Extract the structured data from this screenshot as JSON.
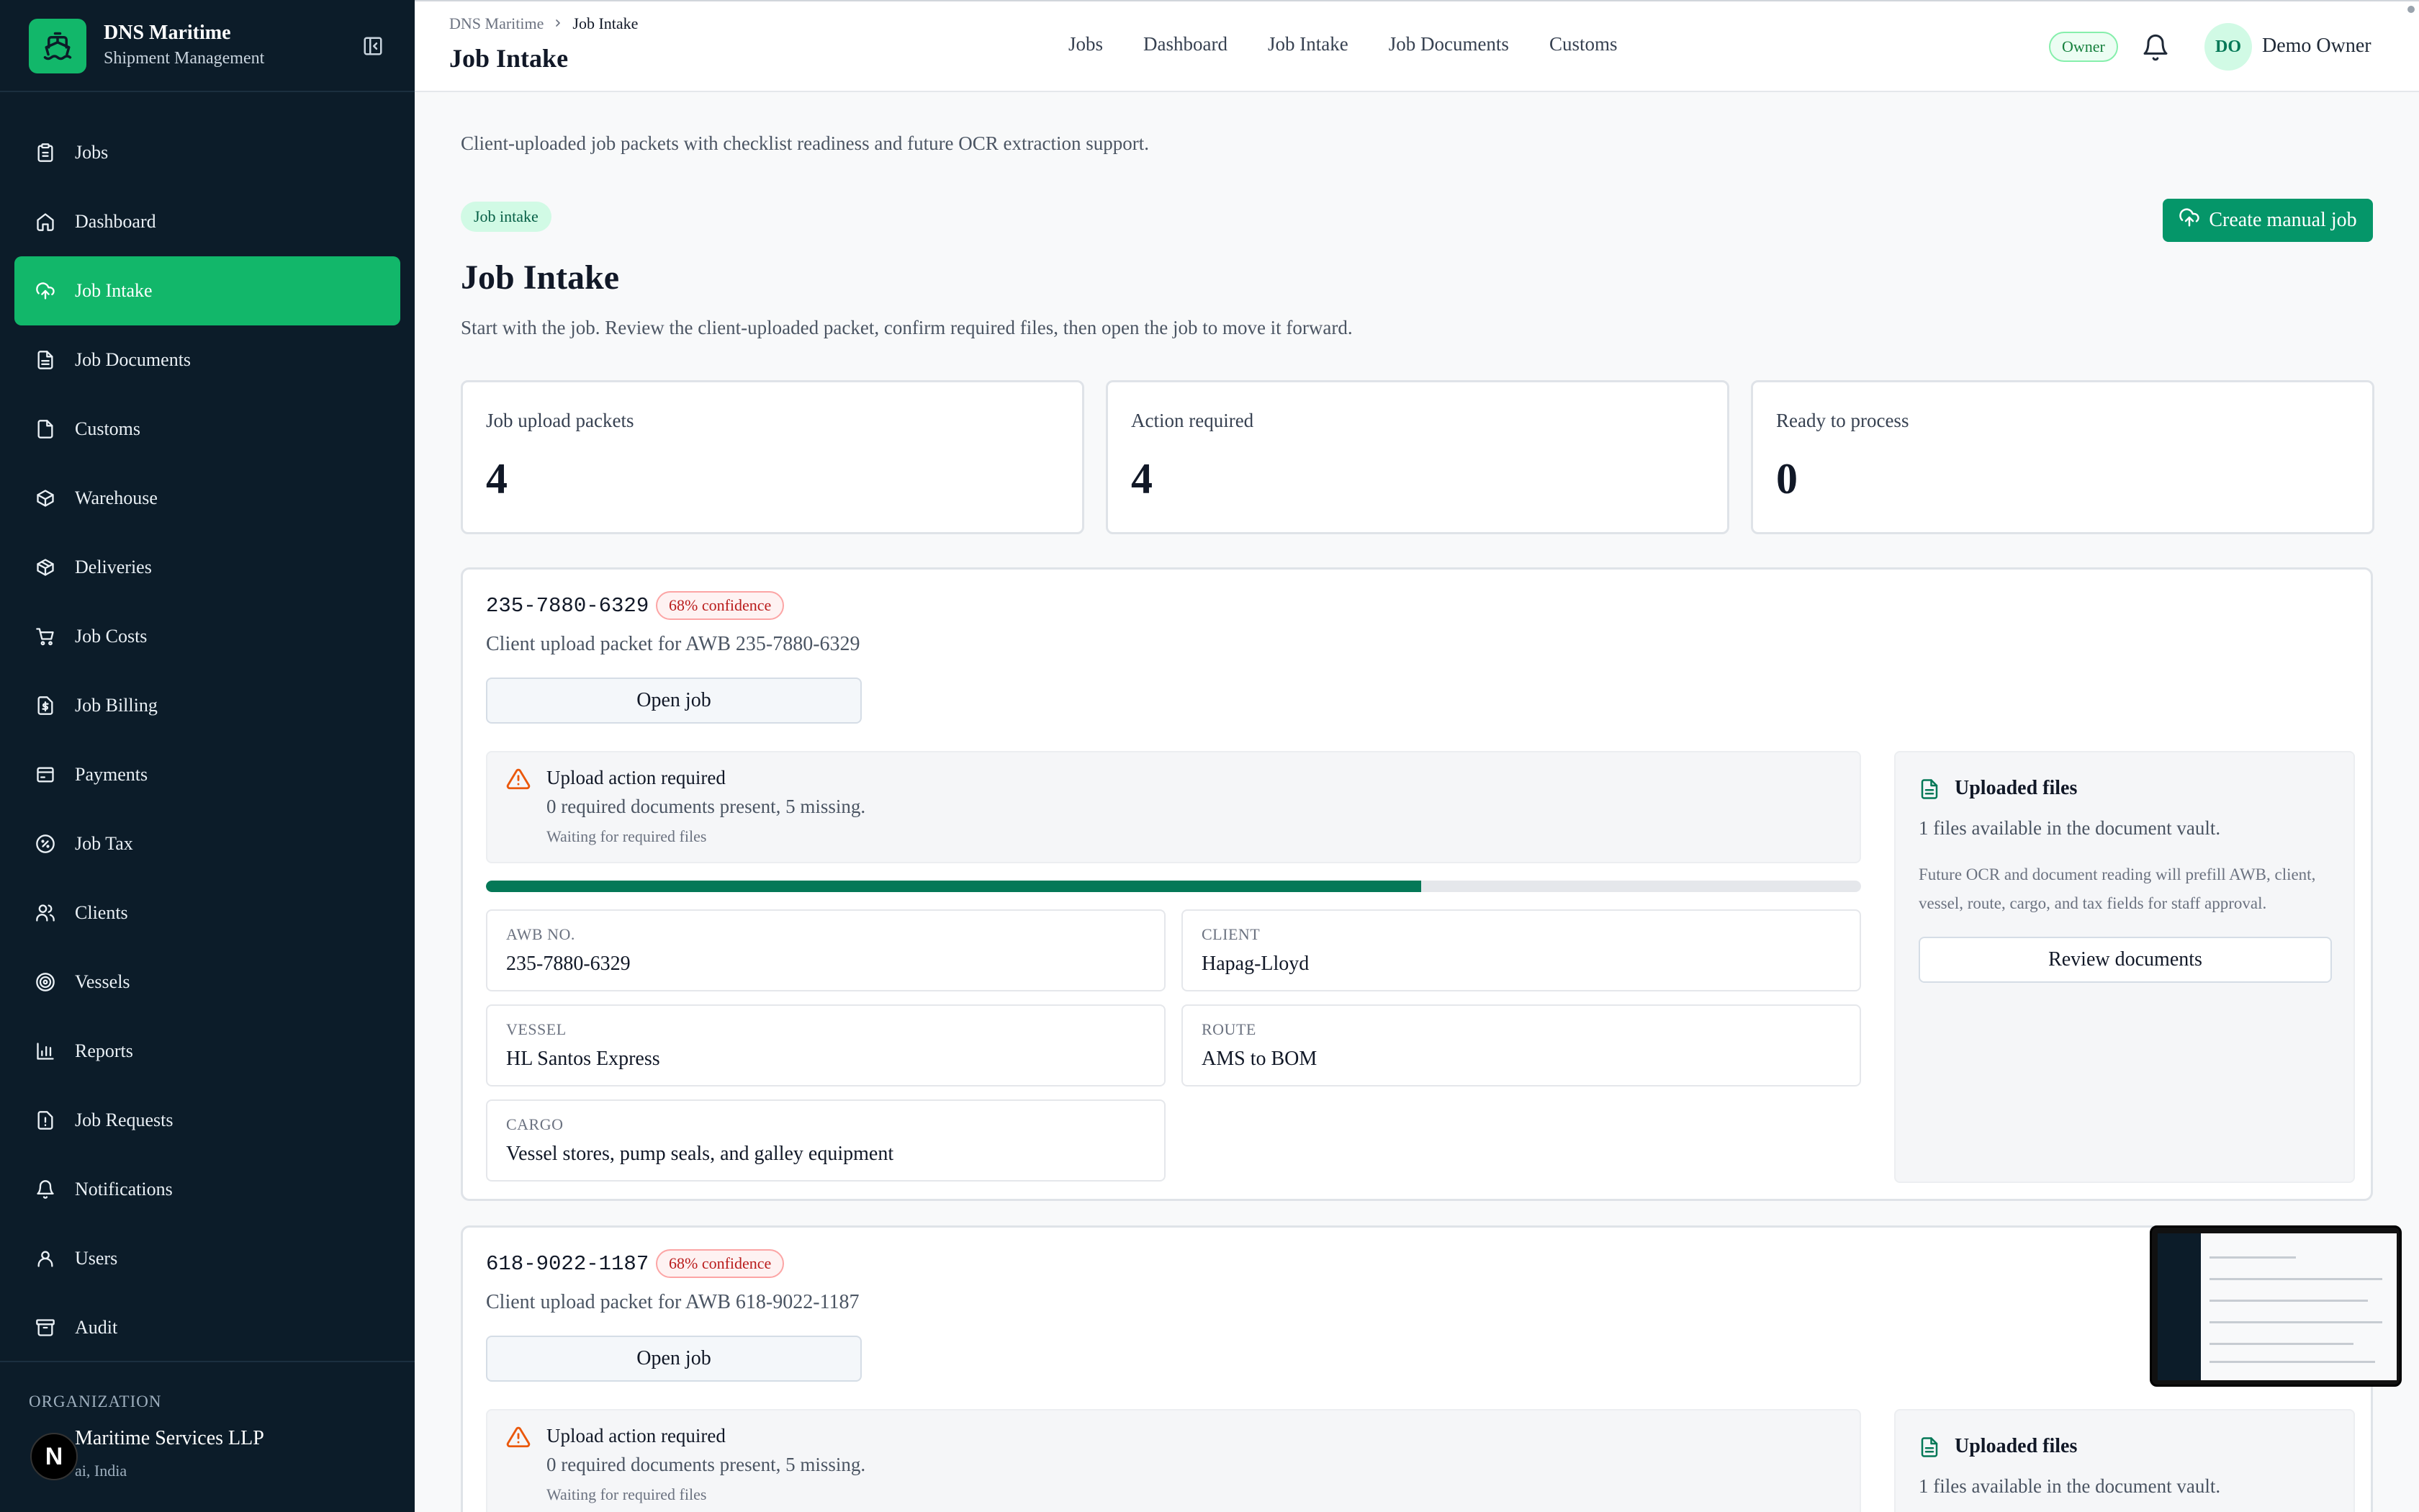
{
  "brand": {
    "title": "DNS Maritime",
    "subtitle": "Shipment Management"
  },
  "sidebar": {
    "items": [
      {
        "label": "Jobs",
        "icon": "clipboard-icon"
      },
      {
        "label": "Dashboard",
        "icon": "home-icon"
      },
      {
        "label": "Job Intake",
        "icon": "cloud-upload-icon",
        "active": true
      },
      {
        "label": "Job Documents",
        "icon": "file-text-icon"
      },
      {
        "label": "Customs",
        "icon": "file-icon"
      },
      {
        "label": "Warehouse",
        "icon": "package-icon"
      },
      {
        "label": "Deliveries",
        "icon": "box-icon"
      },
      {
        "label": "Job Costs",
        "icon": "cart-icon"
      },
      {
        "label": "Job Billing",
        "icon": "dollar-file-icon"
      },
      {
        "label": "Payments",
        "icon": "wallet-icon"
      },
      {
        "label": "Job Tax",
        "icon": "percent-badge-icon"
      },
      {
        "label": "Clients",
        "icon": "users-icon"
      },
      {
        "label": "Vessels",
        "icon": "target-icon"
      },
      {
        "label": "Reports",
        "icon": "bar-chart-icon"
      },
      {
        "label": "Job Requests",
        "icon": "file-alert-icon"
      },
      {
        "label": "Notifications",
        "icon": "bell-icon"
      },
      {
        "label": "Users",
        "icon": "user-icon"
      },
      {
        "label": "Audit",
        "icon": "archive-icon"
      }
    ],
    "org_label": "ORGANIZATION",
    "org_name": "Maritime Services LLP",
    "org_location": "ai, India"
  },
  "topbar": {
    "breadcrumb": [
      "DNS Maritime",
      "Job Intake"
    ],
    "title": "Job Intake",
    "nav": [
      "Jobs",
      "Dashboard",
      "Job Intake",
      "Job Documents",
      "Customs"
    ],
    "role": "Owner",
    "avatar_initials": "DO",
    "user_name": "Demo Owner"
  },
  "main": {
    "intro": "Client-uploaded job packets with checklist readiness and future OCR extraction support.",
    "chip": "Job intake",
    "create_button": "Create manual job",
    "title": "Job Intake",
    "subtitle": "Start with the job. Review the client-uploaded packet, confirm required files, then open the job to move it forward.",
    "stats": [
      {
        "label": "Job upload packets",
        "value": "4"
      },
      {
        "label": "Action required",
        "value": "4"
      },
      {
        "label": "Ready to process",
        "value": "0"
      }
    ],
    "packets": [
      {
        "awb": "235-7880-6329",
        "confidence": "68% confidence",
        "description": "Client upload packet for AWB 235-7880-6329",
        "open_label": "Open job",
        "alert_title": "Upload action required",
        "alert_detail": "0 required documents present, 5 missing.",
        "alert_status": "Waiting for required files",
        "progress": 0.68,
        "fields": {
          "awb_key": "AWB NO.",
          "awb_value": "235-7880-6329",
          "client_key": "CLIENT",
          "client_value": "Hapag-Lloyd",
          "vessel_key": "VESSEL",
          "vessel_value": "HL Santos Express",
          "route_key": "ROUTE",
          "route_value": "AMS to BOM",
          "cargo_key": "CARGO",
          "cargo_value": "Vessel stores, pump seals, and galley equipment"
        },
        "files_title": "Uploaded files",
        "files_count": "1 files available in the document vault.",
        "files_note": "Future OCR and document reading will prefill AWB, client, vessel, route, cargo, and tax fields for staff approval.",
        "review_label": "Review documents"
      },
      {
        "awb": "618-9022-1187",
        "confidence": "68% confidence",
        "description": "Client upload packet for AWB 618-9022-1187",
        "open_label": "Open job",
        "alert_title": "Upload action required",
        "alert_detail": "0 required documents present, 5 missing.",
        "alert_status": "Waiting for required files",
        "files_title": "Uploaded files",
        "files_count": "1 files available in the document vault."
      }
    ]
  },
  "next_badge": "N",
  "colors": {
    "accent": "#12b76a",
    "sidebar_bg": "#0c1c29",
    "progress": "#047857",
    "warning": "#ea580c"
  }
}
